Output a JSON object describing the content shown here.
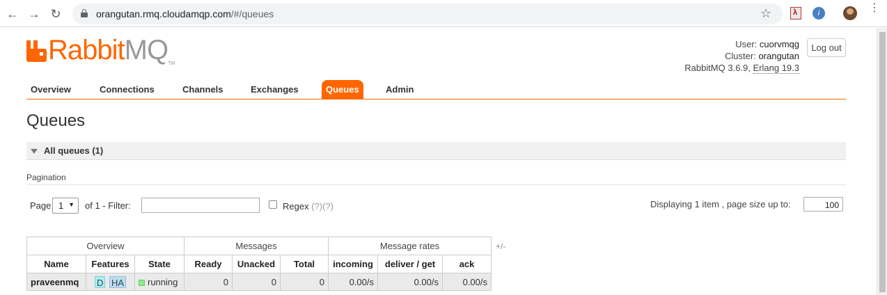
{
  "browser": {
    "url_host": "orangutan.rmq.cloudamqp.com",
    "url_path": "/#/queues",
    "icons": [
      "back-arrow-icon",
      "forward-arrow-icon",
      "reload-icon",
      "lock-icon",
      "star-icon",
      "pdf-extension-icon",
      "extension-icon",
      "profile-avatar",
      "menu-dots-icon"
    ]
  },
  "brand": {
    "name_main": "Rabbit",
    "name_mq": "MQ",
    "tm": "TM",
    "color": "#ff6600"
  },
  "user_info": {
    "user_label": "User:",
    "user": "cuorvmqg",
    "cluster_label": "Cluster:",
    "cluster": "orangutan",
    "version": "RabbitMQ 3.6.9,",
    "erlang": "Erlang 19.3",
    "logout": "Log out"
  },
  "tabs": [
    {
      "label": "Overview"
    },
    {
      "label": "Connections"
    },
    {
      "label": "Channels"
    },
    {
      "label": "Exchanges"
    },
    {
      "label": "Queues",
      "active": true
    },
    {
      "label": "Admin"
    }
  ],
  "page_title": "Queues",
  "section": {
    "title": "All queues (1)"
  },
  "pagination": {
    "label": "Pagination",
    "page_word": "Page",
    "page_selected": "1",
    "of_text": "of 1  - Filter:",
    "filter_value": "",
    "regex_label": "Regex",
    "regex_help": "(?)(?)",
    "displaying": "Displaying 1 item , page size up to:",
    "page_size": "100"
  },
  "table": {
    "groups": [
      "Overview",
      "Messages",
      "Message rates"
    ],
    "plus_minus": "+/-",
    "columns": [
      "Name",
      "Features",
      "State",
      "Ready",
      "Unacked",
      "Total",
      "incoming",
      "deliver / get",
      "ack"
    ],
    "rows": [
      {
        "name": "praveenmq",
        "features": [
          "D",
          "HA"
        ],
        "state": "running",
        "ready": "0",
        "unacked": "0",
        "total": "0",
        "incoming": "0.00/s",
        "deliver_get": "0.00/s",
        "ack": "0.00/s"
      }
    ]
  }
}
